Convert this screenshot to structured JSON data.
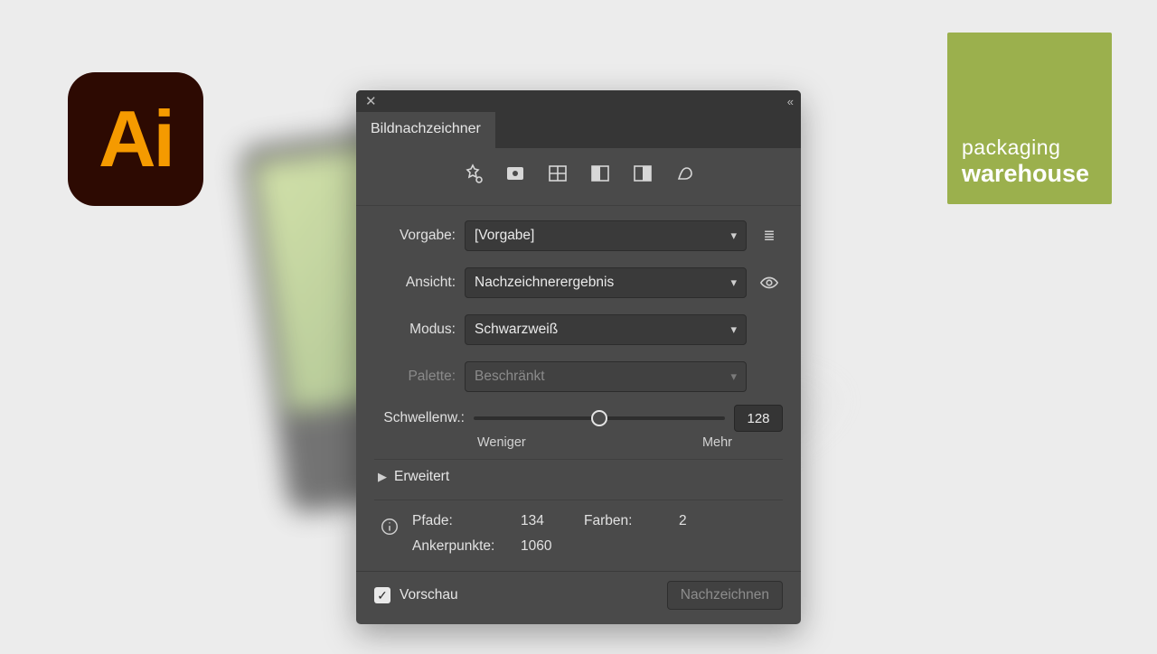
{
  "background_logos": {
    "ai_text": "Ai",
    "pw_line1": "packaging",
    "pw_line2": "warehouse"
  },
  "panel": {
    "tab_title": "Bildnachzeichner",
    "icons": [
      "auto-color-icon",
      "high-color-icon",
      "low-color-icon",
      "grayscale-icon",
      "black-white-icon",
      "outline-icon"
    ],
    "preset": {
      "label": "Vorgabe:",
      "value": "[Vorgabe]",
      "menu_icon": "preset-menu-icon"
    },
    "view": {
      "label": "Ansicht:",
      "value": "Nachzeichnerergebnis",
      "eye_icon": "visibility-icon"
    },
    "mode": {
      "label": "Modus:",
      "value": "Schwarzweiß"
    },
    "palette": {
      "label": "Palette:",
      "value": "Beschränkt"
    },
    "threshold": {
      "label": "Schwellenw.:",
      "value": "128",
      "less": "Weniger",
      "more": "Mehr"
    },
    "advanced_label": "Erweitert",
    "info": {
      "paths_label": "Pfade:",
      "paths_value": "134",
      "colors_label": "Farben:",
      "colors_value": "2",
      "anchors_label": "Ankerpunkte:",
      "anchors_value": "1060"
    },
    "footer": {
      "preview_label": "Vorschau",
      "preview_checked": true,
      "trace_button": "Nachzeichnen"
    }
  }
}
